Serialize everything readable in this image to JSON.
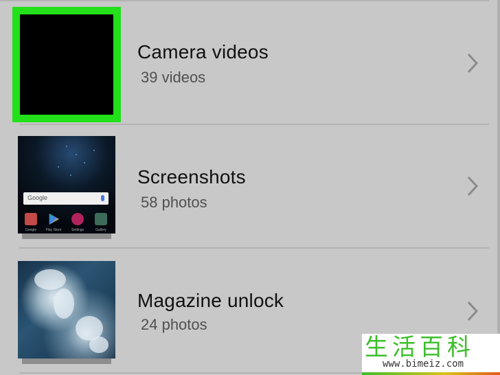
{
  "albums": [
    {
      "title": "Camera videos",
      "count": "39 videos"
    },
    {
      "title": "Screenshots",
      "count": "58 photos"
    },
    {
      "title": "Magazine unlock",
      "count": "24 photos"
    }
  ],
  "screenshot_thumb": {
    "search_text": "Google",
    "apps": [
      "Google",
      "Play Store",
      "Settings",
      "Gallery"
    ]
  },
  "watermark": {
    "chinese": "生活百科",
    "url": "www.bimeiz.com"
  },
  "colors": {
    "selection": "#22e01a",
    "background": "#c8c8c8"
  },
  "icons": [
    "chevron-right-icon",
    "mic-icon"
  ]
}
